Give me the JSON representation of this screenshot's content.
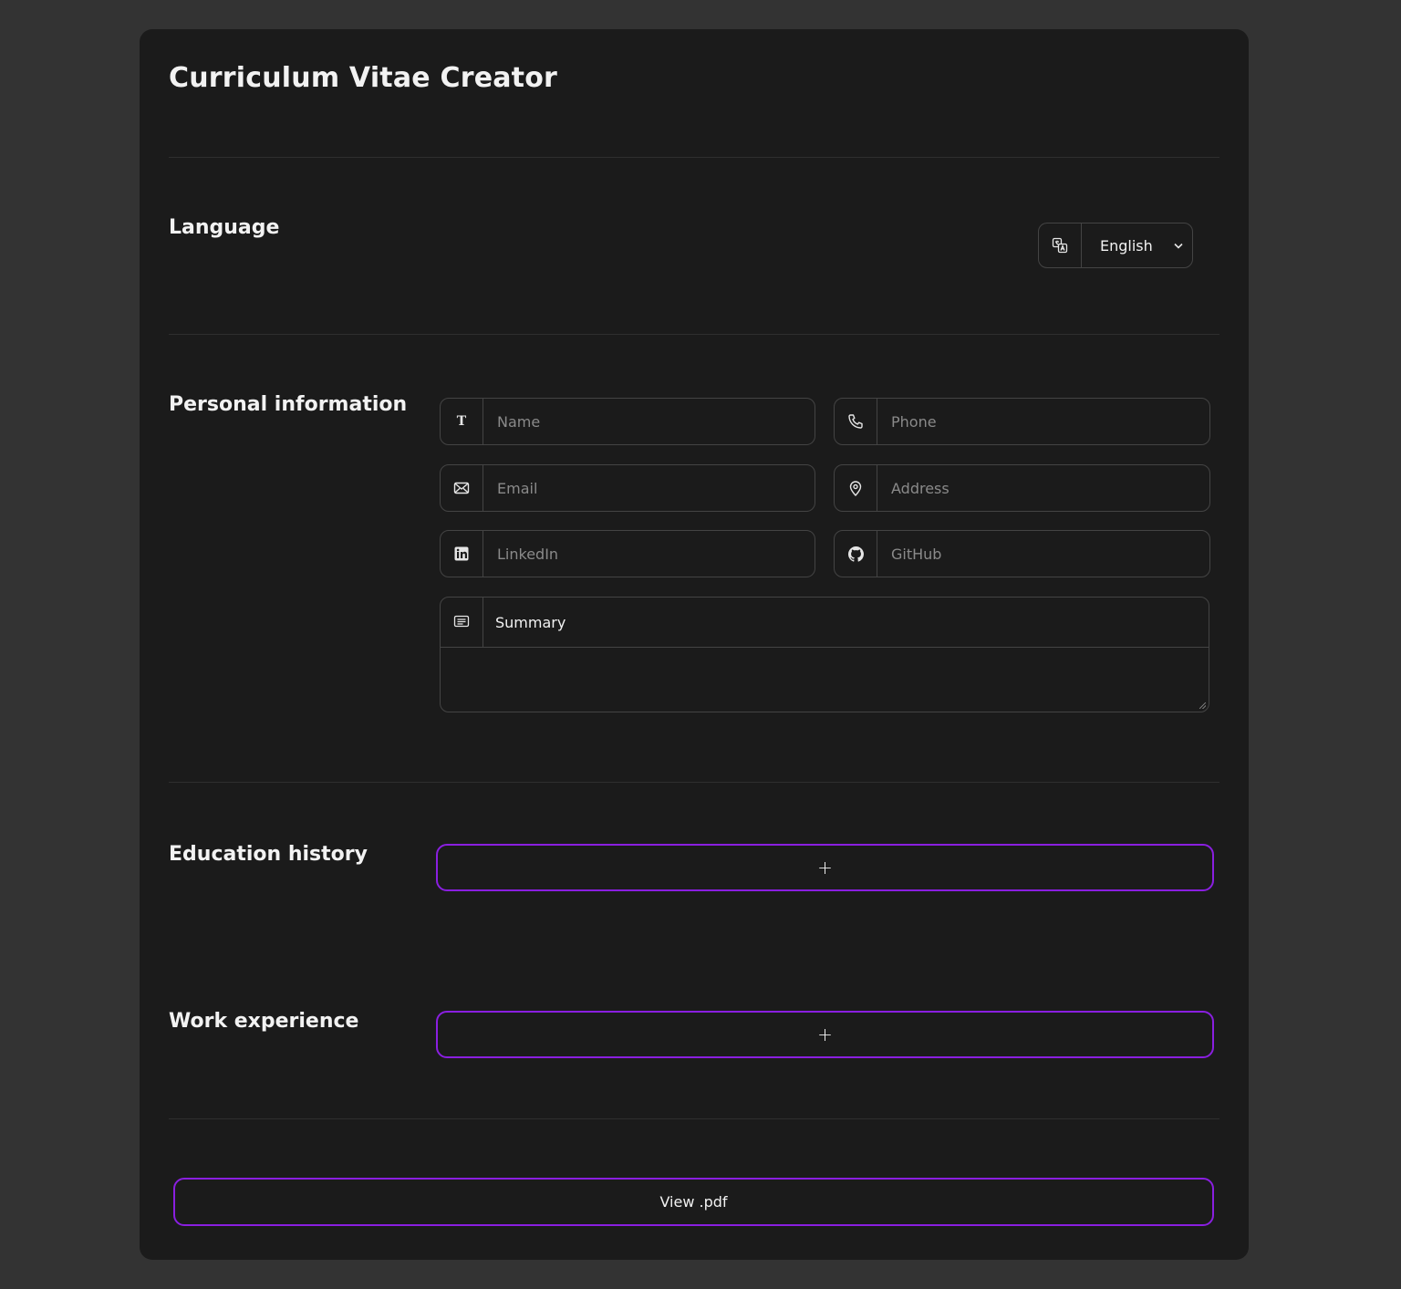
{
  "app": {
    "title": "Curriculum Vitae Creator"
  },
  "language": {
    "heading": "Language",
    "icon": "translate-icon",
    "selected": "English"
  },
  "personal": {
    "heading": "Personal information",
    "name_placeholder": "Name",
    "phone_placeholder": "Phone",
    "email_placeholder": "Email",
    "address_placeholder": "Address",
    "linkedin_placeholder": "LinkedIn",
    "github_placeholder": "GitHub",
    "summary_label": "Summary",
    "summary_value": ""
  },
  "education": {
    "heading": "Education history",
    "add_label": "+"
  },
  "work": {
    "heading": "Work experience",
    "add_label": "+"
  },
  "actions": {
    "view_pdf_label": "View .pdf"
  },
  "colors": {
    "background": "#333333",
    "card": "#1b1b1b",
    "accent": "#8a1fe0",
    "border": "#444444"
  }
}
